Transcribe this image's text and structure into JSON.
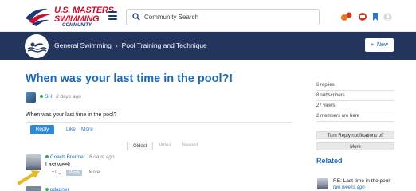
{
  "brand": {
    "line1": "U.S. MASTERS",
    "line2": "SWIMMING",
    "line3": "COMMUNITY",
    "color_red": "#c8102e",
    "color_navy": "#1b3a74"
  },
  "search": {
    "placeholder": "Community Search",
    "icon": "search-icon"
  },
  "header_icons": [
    "notifications-icon",
    "messages-icon",
    "bookmark-icon",
    "user-icon"
  ],
  "banner": {
    "bg": "#23345d",
    "breadcrumb": [
      "General Swimming",
      "Pool Training and Technique"
    ],
    "new_button": "New"
  },
  "thread": {
    "title": "When was your last time in the pool?!",
    "author_initials": "SH",
    "time": "8 days ago",
    "body": "When was your last time in the pool?",
    "reply_label": "Reply",
    "like_label": "Like",
    "more_label": "More"
  },
  "sort": [
    "Oldest",
    "Votes",
    "Newest"
  ],
  "replies": [
    {
      "author": "Coach Brenner",
      "time": "8 days ago",
      "body": "Last week.",
      "votes": "0",
      "reply_label": "Reply",
      "more_label": "More"
    },
    {
      "author": "pdagner"
    }
  ],
  "sidebar": {
    "stats": [
      "6 replies",
      "8 subscribers",
      "27 views",
      "2 members are here"
    ],
    "notif_button": "Turn Reply notifications off",
    "more_button": "More",
    "related_heading": "Related",
    "related": [
      {
        "title": "RE: Last time in the pool!",
        "time": "two weeks ago"
      }
    ]
  },
  "accent": "#1b6ab9"
}
